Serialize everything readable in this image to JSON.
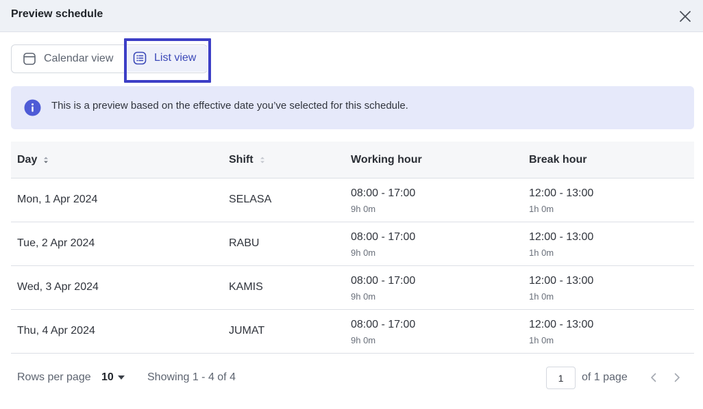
{
  "header": {
    "title": "Preview schedule",
    "close_icon": "close-icon"
  },
  "view_toggle": {
    "calendar_label": "Calendar view",
    "calendar_icon": "calendar-icon",
    "list_label": "List view",
    "list_icon": "list-icon",
    "selected": "List view"
  },
  "banner": {
    "icon": "info-icon",
    "message": "This is a preview based on the effective date you’ve selected for this schedule."
  },
  "table": {
    "columns": [
      "Day",
      "Shift",
      "Working hour",
      "Break hour"
    ],
    "rows": [
      {
        "day": "Mon, 1 Apr 2024",
        "shift": "SELASA",
        "working": "08:00 - 17:00",
        "working_duration": "9h 0m",
        "break": "12:00 - 13:00",
        "break_duration": "1h 0m"
      },
      {
        "day": "Tue, 2 Apr 2024",
        "shift": "RABU",
        "working": "08:00 - 17:00",
        "working_duration": "9h 0m",
        "break": "12:00 - 13:00",
        "break_duration": "1h 0m"
      },
      {
        "day": "Wed, 3 Apr 2024",
        "shift": "KAMIS",
        "working": "08:00 - 17:00",
        "working_duration": "9h 0m",
        "break": "12:00 - 13:00",
        "break_duration": "1h 0m"
      },
      {
        "day": "Thu, 4 Apr 2024",
        "shift": "JUMAT",
        "working": "08:00 - 17:00",
        "working_duration": "9h 0m",
        "break": "12:00 - 13:00",
        "break_duration": "1h 0m"
      }
    ]
  },
  "footer": {
    "rows_per_page_label": "Rows per page",
    "rows_per_page_value": "10",
    "showing": "Showing 1 - 4 of 4",
    "page_value": "1",
    "of_page": "of 1 page"
  },
  "colors": {
    "accent": "#3b48b8",
    "focus_ring": "#3d3fc6",
    "banner_bg": "#e6e9fa",
    "info_icon": "#4e5bd6"
  }
}
